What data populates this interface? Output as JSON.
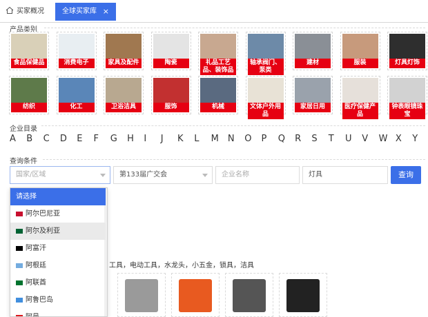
{
  "tabs": {
    "home_label": "买家概况",
    "active_label": "全球买家库",
    "close_glyph": "×"
  },
  "sections": {
    "product_category": "产品类别",
    "company_directory": "企业目录",
    "query_conditions": "查询条件"
  },
  "categories": [
    {
      "label": "食品保健品",
      "color": "#d9d0b8"
    },
    {
      "label": "消费电子",
      "color": "#e8eef2"
    },
    {
      "label": "家具及配件",
      "color": "#a07850"
    },
    {
      "label": "陶瓷",
      "color": "#e4e4e4"
    },
    {
      "label": "礼品工艺品、装饰品",
      "color": "#c8a890"
    },
    {
      "label": "轴承阀门、泵类",
      "color": "#6d8aa8"
    },
    {
      "label": "建材",
      "color": "#8a8f96"
    },
    {
      "label": "服装",
      "color": "#c79a7c"
    },
    {
      "label": "灯具灯饰",
      "color": "#2e2e2e"
    },
    {
      "label": "纺织",
      "color": "#5e7a4a"
    },
    {
      "label": "化工",
      "color": "#5a86b8"
    },
    {
      "label": "卫浴洁具",
      "color": "#b8a890"
    },
    {
      "label": "服饰",
      "color": "#c23030"
    },
    {
      "label": "机械",
      "color": "#5a6a80"
    },
    {
      "label": "文体户外用品",
      "color": "#e8e2d6"
    },
    {
      "label": "家居日用",
      "color": "#9aa2ac"
    },
    {
      "label": "医疗保健产品",
      "color": "#e6e0da"
    },
    {
      "label": "钟表眼镜珠宝",
      "color": "#d2d2d2"
    }
  ],
  "letters": [
    "A",
    "B",
    "C",
    "D",
    "E",
    "F",
    "G",
    "H",
    "I",
    "J",
    "K",
    "L",
    "M",
    "N",
    "O",
    "P",
    "Q",
    "R",
    "S",
    "T",
    "U",
    "V",
    "W",
    "X",
    "Y"
  ],
  "query": {
    "region_placeholder": "国家/区域",
    "fair_value": "第133届广交会",
    "company_placeholder": "企业名称",
    "keyword_value": "灯具",
    "search_label": "查询"
  },
  "dropdown": {
    "options": [
      {
        "label": "请选择",
        "flag": ""
      },
      {
        "label": "阿尔巴尼亚",
        "flag": "#c8102e"
      },
      {
        "label": "阿尔及利亚",
        "flag": "#006233"
      },
      {
        "label": "阿富汗",
        "flag": "#000000"
      },
      {
        "label": "阿根廷",
        "flag": "#74acdf"
      },
      {
        "label": "阿联酋",
        "flag": "#00732f"
      },
      {
        "label": "阿鲁巴岛",
        "flag": "#418fde"
      },
      {
        "label": "阿曼",
        "flag": "#db161b"
      }
    ]
  },
  "product_tags": "工具，电动工具，水龙头，小五金，锁具，洁具",
  "products": [
    {
      "color": "#9a9a9a"
    },
    {
      "color": "#e85a20"
    },
    {
      "color": "#555555"
    },
    {
      "color": "#222222"
    }
  ]
}
